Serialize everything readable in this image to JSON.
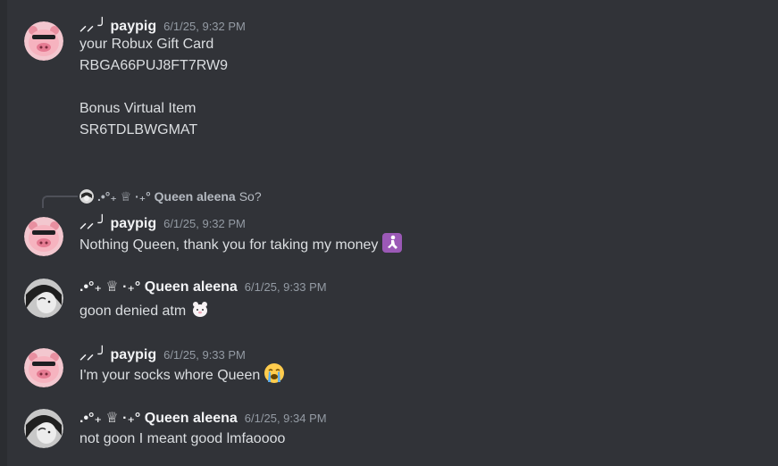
{
  "messages": [
    {
      "author": "⸝⸝ ╯ paypig",
      "timestamp": "6/1/25, 9:32 PM",
      "lines": [
        "your Robux Gift Card",
        "RBGA66PUJ8FT7RW9",
        "",
        "Bonus Virtual Item",
        "SR6TDLBWGMAT"
      ]
    },
    {
      "author": "⸝⸝ ╯ paypig",
      "timestamp": "6/1/25, 9:32 PM",
      "text": "Nothing Queen, thank you for taking my money",
      "reply": {
        "author": ".•°₊ ♕ ·₊° Queen aleena",
        "text": "So?"
      }
    },
    {
      "author": ".•°₊ ♕ ·₊° Queen aleena",
      "timestamp": "6/1/25, 9:33 PM",
      "text": "goon denied atm"
    },
    {
      "author": "⸝⸝ ╯ paypig",
      "timestamp": "6/1/25, 9:33 PM",
      "text": "I'm your socks whore Queen"
    },
    {
      "author": ".•°₊ ♕ ·₊° Queen aleena",
      "timestamp": "6/1/25, 9:34 PM",
      "text": "not goon I meant good lmfaoooo"
    }
  ],
  "icons": {
    "pig_avatar": "pig-avatar-icon",
    "queen_avatar": "queen-avatar-icon",
    "kneel_emoji": "kneeling-person-emoji",
    "bear_emoji": "white-bear-emoji",
    "crying_emoji": "loudly-crying-face-emoji"
  },
  "colors": {
    "background": "#313338",
    "username": "#f2f3f5",
    "text": "#dbdee1",
    "timestamp": "#949ba4",
    "pig_pink": "#f4a7b0"
  }
}
